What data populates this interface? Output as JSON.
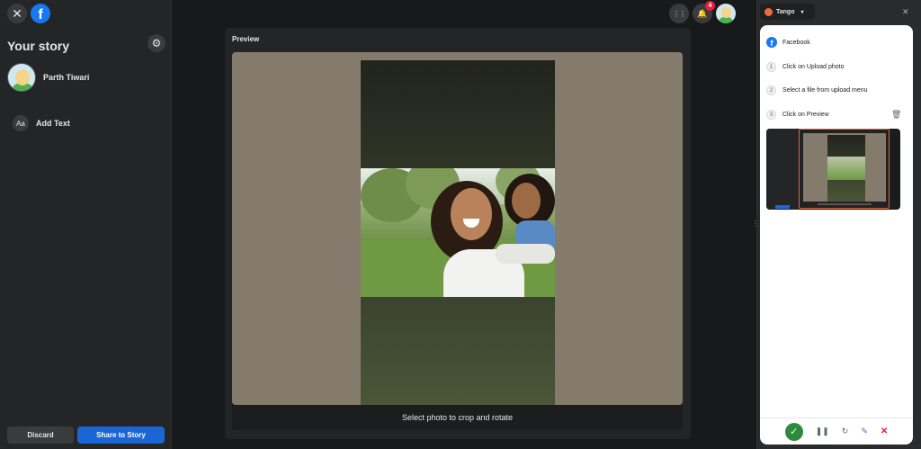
{
  "sidebar": {
    "title": "Your story",
    "user_name": "Parth Tiwari",
    "add_text_icon": "Aa",
    "add_text_label": "Add Text",
    "discard_label": "Discard",
    "share_label": "Share to Story",
    "close_glyph": "✕",
    "logo_glyph": "f",
    "settings_glyph": "⚙"
  },
  "topbar": {
    "menu_glyph": "⋮⋮",
    "bell_glyph": "🔔",
    "notification_count": "4"
  },
  "preview": {
    "label": "Preview",
    "crop_hint": "Select photo to crop and rotate"
  },
  "tango": {
    "name": "Tango",
    "caret": "▾",
    "close_glyph": "✕",
    "site_glyph": "f",
    "site_name": "Facebook",
    "steps": [
      {
        "num": "1",
        "text": "Click on Upload photo"
      },
      {
        "num": "2",
        "text": "Select a file from upload menu"
      },
      {
        "num": "3",
        "text": "Click on Preview"
      }
    ],
    "trash_glyph": "🗑",
    "toolbar": {
      "check": "✓",
      "pause": "❚❚",
      "redo": "↻",
      "edit": "✎",
      "stop": "✕"
    }
  },
  "colors": {
    "brand": "#1877f2",
    "share_button": "#1b66d6",
    "badge": "#e41e3f",
    "tango_accent": "#e8642f",
    "done_green": "#2e8b3e",
    "preview_bg": "#857b6d"
  }
}
